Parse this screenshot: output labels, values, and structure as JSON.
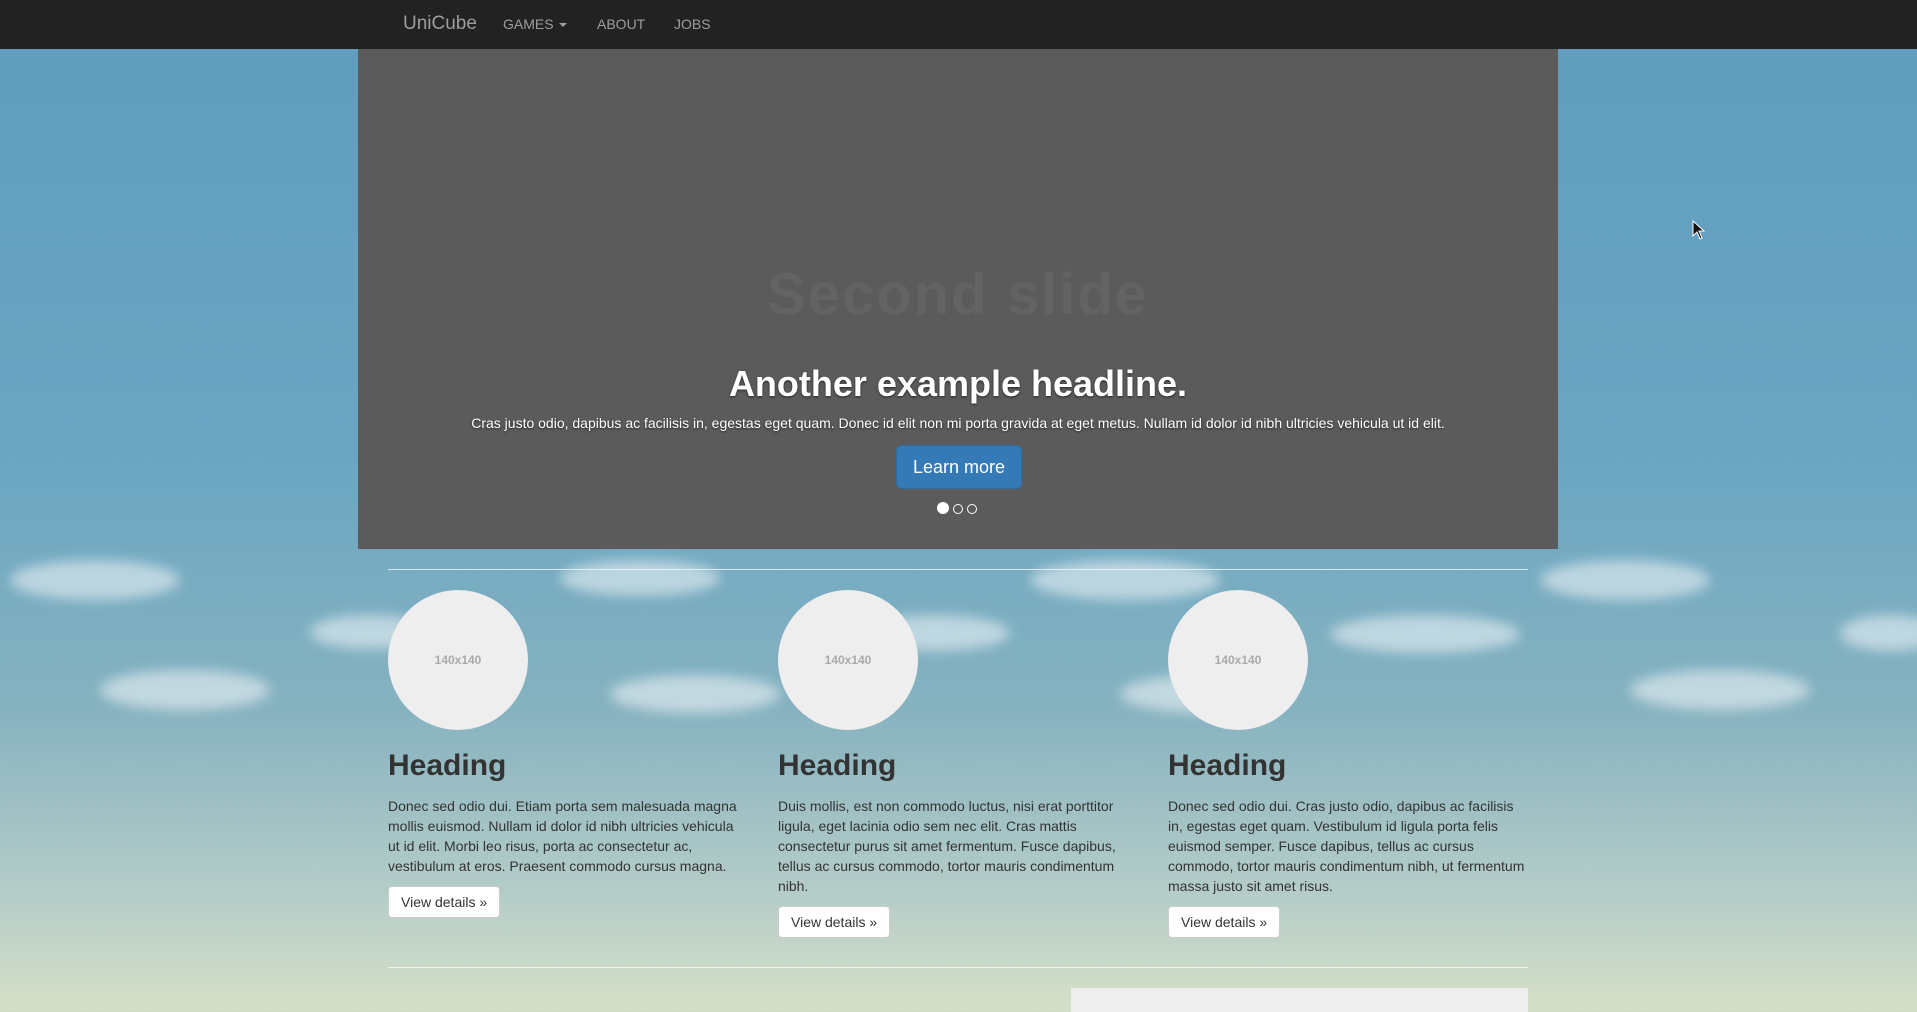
{
  "navbar": {
    "brand": "UniCube",
    "links": [
      {
        "label": "GAMES"
      },
      {
        "label": "ABOUT"
      },
      {
        "label": "JOBS"
      }
    ]
  },
  "carousel": {
    "slide_placeholder": "Second slide",
    "headline": "Another example headline.",
    "text": "Cras justo odio, dapibus ac facilisis in, egestas eget quam. Donec id elit non mi porta gravida at eget metus. Nullam id dolor id nibh ultricies vehicula ut id elit.",
    "button": "Learn more",
    "slide_count": 3,
    "active_slide": 1
  },
  "features": [
    {
      "image_label": "140x140",
      "heading": "Heading",
      "text": "Donec sed odio dui. Etiam porta sem malesuada magna mollis euismod. Nullam id dolor id nibh ultricies vehicula ut id elit. Morbi leo risus, porta ac consectetur ac, vestibulum at eros. Praesent commodo cursus magna.",
      "button": "View details »"
    },
    {
      "image_label": "140x140",
      "heading": "Heading",
      "text": "Duis mollis, est non commodo luctus, nisi erat porttitor ligula, eget lacinia odio sem nec elit. Cras mattis consectetur purus sit amet fermentum. Fusce dapibus, tellus ac cursus commodo, tortor mauris condimentum nibh.",
      "button": "View details »"
    },
    {
      "image_label": "140x140",
      "heading": "Heading",
      "text": "Donec sed odio dui. Cras justo odio, dapibus ac facilisis in, egestas eget quam. Vestibulum id ligula porta felis euismod semper. Fusce dapibus, tellus ac cursus commodo, tortor mauris condimentum nibh, ut fermentum massa justo sit amet risus.",
      "button": "View details »"
    }
  ],
  "colors": {
    "navbar": "#222222",
    "primary": "#337ab7",
    "carousel_bg": "#5b5b5b"
  }
}
